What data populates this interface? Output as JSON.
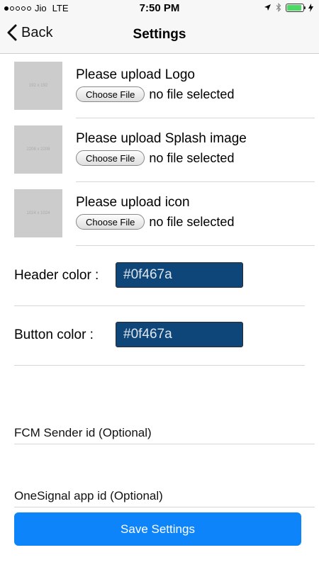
{
  "status_bar": {
    "carrier": "Jio",
    "network": "LTE",
    "time": "7:50 PM",
    "signal_bars": 1,
    "battery_fraction": 0.9
  },
  "nav": {
    "back_label": "Back",
    "title": "Settings"
  },
  "uploads": [
    {
      "thumb_text": "192 x 192",
      "title": "Please upload Logo",
      "button_label": "Choose File",
      "status": "no file selected"
    },
    {
      "thumb_text": "2208 x 2208",
      "title": "Please upload Splash image",
      "button_label": "Choose File",
      "status": "no file selected"
    },
    {
      "thumb_text": "1024 x 1024",
      "title": "Please upload icon",
      "button_label": "Choose File",
      "status": "no file selected"
    }
  ],
  "colors": {
    "header": {
      "label": "Header color :",
      "value": "#0f467a"
    },
    "button": {
      "label": "Button color :",
      "value": "#0f467a"
    }
  },
  "fields": {
    "fcm_placeholder": "FCM Sender id (Optional)",
    "onesignal_placeholder": "OneSignal app id (Optional)"
  },
  "save_label": "Save Settings",
  "theme": {
    "accent": "#0d84fa",
    "battery": "#4cd964"
  }
}
